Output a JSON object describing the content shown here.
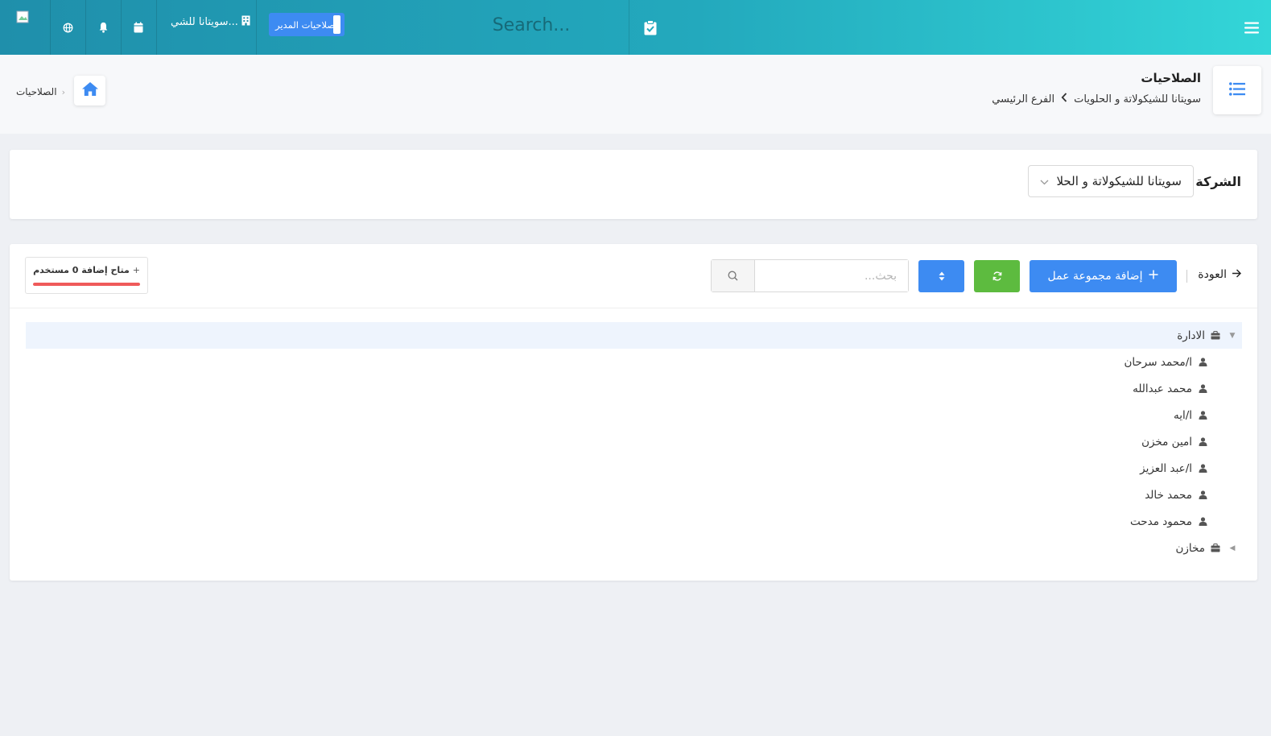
{
  "topbar": {
    "search_placeholder": "Search...",
    "company_short": "سويتانا للشي...",
    "permissions_button": "صلاحيات المدير"
  },
  "header": {
    "title": "الصلاحيات",
    "breadcrumb": [
      "سويتانا للشيكولاتة و الحلويات",
      "الفرع الرئيسي"
    ],
    "small_breadcrumb": "الصلاحيات"
  },
  "company_filter": {
    "label": "الشركة",
    "selected": "سويتانا للشيكولاتة و الحلا"
  },
  "toolbar": {
    "back_label": "العودة",
    "add_group_label": "إضافة مجموعة عمل",
    "search_placeholder": "بحث..."
  },
  "quota": {
    "label": "متاح إضافة 0 مستخدم",
    "fill_fraction": 1.0,
    "color": "#ef5a5a"
  },
  "tree": [
    {
      "type": "group",
      "label": "الادارة",
      "expanded": true,
      "selected": true
    },
    {
      "type": "user",
      "label": "ا/محمد سرحان"
    },
    {
      "type": "user",
      "label": "محمد عبدالله"
    },
    {
      "type": "user",
      "label": "ا/ايه"
    },
    {
      "type": "user",
      "label": "امين مخزن"
    },
    {
      "type": "user",
      "label": "ا/عبد العزيز"
    },
    {
      "type": "user",
      "label": "محمد خالد"
    },
    {
      "type": "user",
      "label": "محمود مدحت"
    },
    {
      "type": "group",
      "label": "مخازن",
      "expanded": false,
      "selected": false
    }
  ],
  "colors": {
    "accent_blue": "#3d8bf2",
    "refresh_green": "#5dbb3f",
    "topbar_start": "#1f8fab",
    "topbar_end": "#33d6d8"
  }
}
